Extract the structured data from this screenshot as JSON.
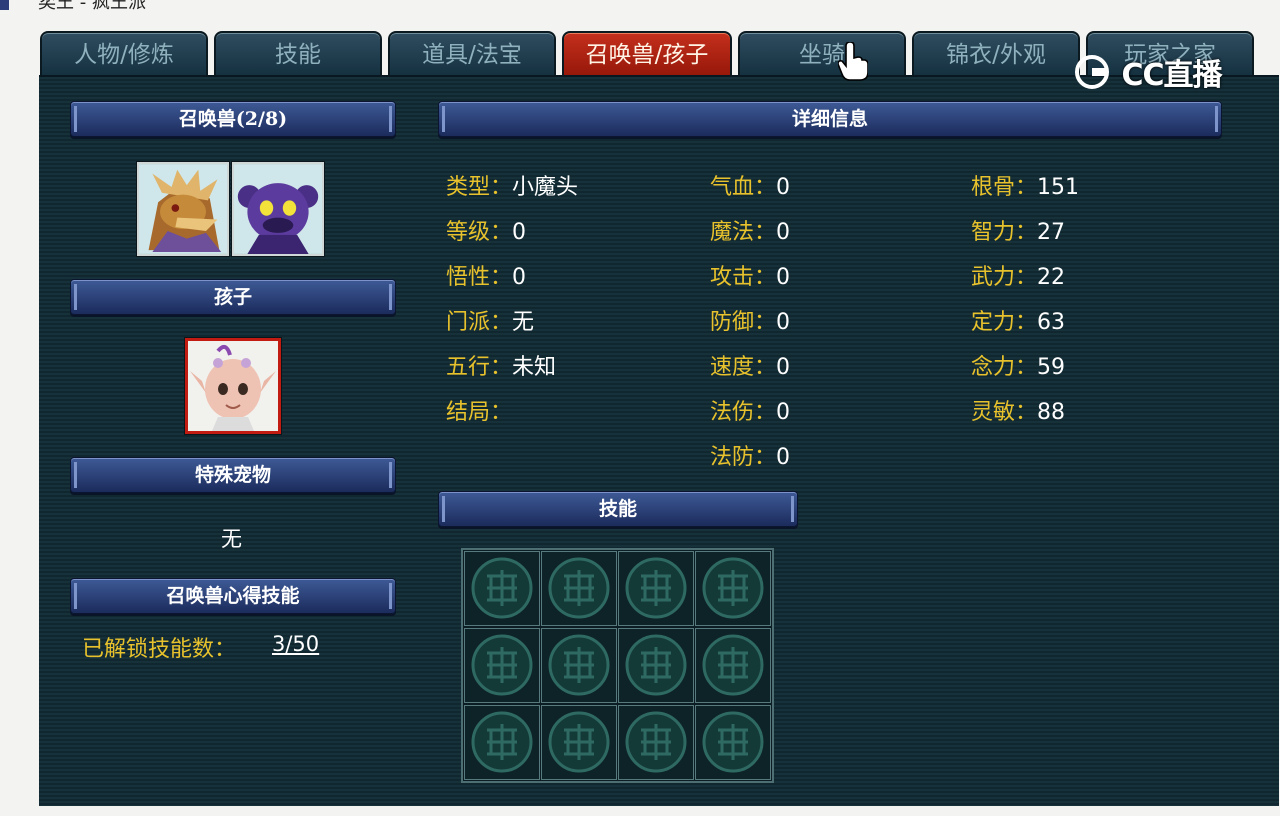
{
  "breadcrumb": "奕王 - 疯王派",
  "tabs": [
    "人物/修炼",
    "技能",
    "道具/法宝",
    "召唤兽/孩子",
    "坐骑",
    "锦衣/外观",
    "玩家之家"
  ],
  "active_tab": "召唤兽/孩子",
  "watermark": "CC直播",
  "left": {
    "pets_header": "召唤兽(2/8)",
    "child_header": "孩子",
    "special_header": "特殊宠物",
    "special_value": "无",
    "skill_header": "召唤兽心得技能",
    "unlocked_label": "已解锁技能数：",
    "unlocked_value": "3/50"
  },
  "detail": {
    "header": "详细信息",
    "col1": [
      {
        "label": "类型：",
        "value": "小魔头"
      },
      {
        "label": "等级：",
        "value": "0"
      },
      {
        "label": "悟性：",
        "value": "0"
      },
      {
        "label": "门派：",
        "value": "无"
      },
      {
        "label": "五行：",
        "value": "未知"
      },
      {
        "label": "结局：",
        "value": ""
      }
    ],
    "col2": [
      {
        "label": "气血：",
        "value": "0"
      },
      {
        "label": "魔法：",
        "value": "0"
      },
      {
        "label": "攻击：",
        "value": "0"
      },
      {
        "label": "防御：",
        "value": "0"
      },
      {
        "label": "速度：",
        "value": "0"
      },
      {
        "label": "法伤：",
        "value": "0"
      },
      {
        "label": "法防：",
        "value": "0"
      }
    ],
    "col3": [
      {
        "label": "根骨：",
        "value": "151"
      },
      {
        "label": "智力：",
        "value": "27"
      },
      {
        "label": "武力：",
        "value": "22"
      },
      {
        "label": "定力：",
        "value": "63"
      },
      {
        "label": "念力：",
        "value": "59"
      },
      {
        "label": "灵敏：",
        "value": "88"
      }
    ]
  },
  "skills": {
    "header": "技能",
    "slot_count": 12,
    "slot_icon": "empty-skill-slot-icon"
  },
  "colors": {
    "label": "#e8c22c",
    "value": "#ffffff",
    "active_tab": "#b8230f",
    "panel": "#13303a"
  }
}
